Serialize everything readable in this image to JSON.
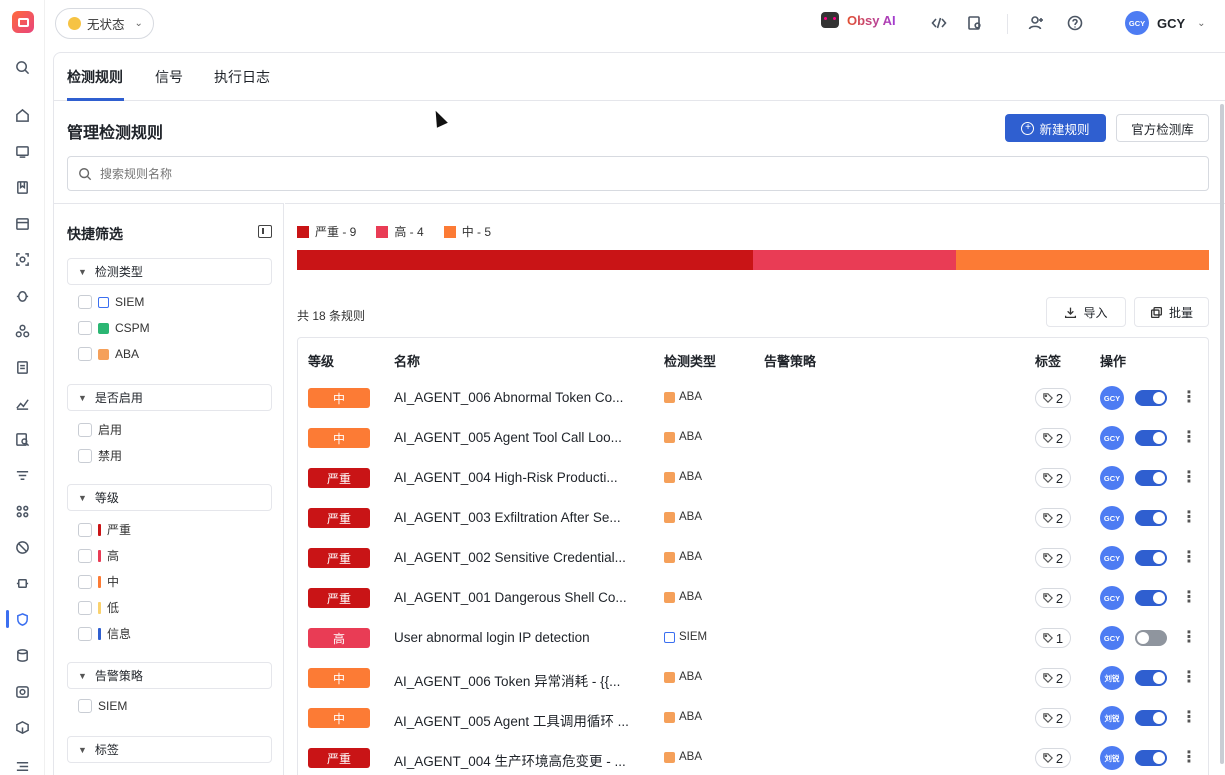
{
  "topbar": {
    "status_label": "无状态",
    "ai_label": "Obsy AI",
    "user_initials": "GCY",
    "user_name": "GCY"
  },
  "tabs": [
    "检测规则",
    "信号",
    "执行日志"
  ],
  "page": {
    "title": "管理检测规则",
    "new_rule_button": "新建规则",
    "official_library_button": "官方检测库",
    "search_placeholder": "搜索规则名称"
  },
  "filters": {
    "title": "快捷筛选",
    "groups": [
      {
        "label": "检测类型",
        "items": [
          "SIEM",
          "CSPM",
          "ABA"
        ]
      },
      {
        "label": "是否启用",
        "items": [
          "启用",
          "禁用"
        ]
      },
      {
        "label": "等级",
        "items": [
          "严重",
          "高",
          "中",
          "低",
          "信息"
        ]
      },
      {
        "label": "告警策略",
        "items": [
          "SIEM"
        ]
      },
      {
        "label": "标签",
        "items": []
      }
    ]
  },
  "colors": {
    "severe": "#c91416",
    "high": "#e93c55",
    "medium": "#fc7b35",
    "low": "#fad26e",
    "info": "#2f5fd0",
    "primary": "#2f5fd0"
  },
  "chart_data": {
    "type": "bar",
    "categories": [
      "严重",
      "高",
      "中"
    ],
    "values": [
      9,
      4,
      5
    ],
    "legend": [
      "严重 - 9",
      "高 - 4",
      "中 - 5"
    ]
  },
  "list": {
    "count_text": "共 18 条规则",
    "import_button": "导入",
    "batch_button": "批量",
    "columns": [
      "等级",
      "名称",
      "检测类型",
      "告警策略",
      "标签",
      "操作"
    ],
    "rows": [
      {
        "level": "中",
        "name": "AI_AGENT_006 Abnormal Token Co...",
        "type": "ABA",
        "tags": "2",
        "owner": "GCY",
        "enabled": true
      },
      {
        "level": "中",
        "name": "AI_AGENT_005 Agent Tool Call Loo...",
        "type": "ABA",
        "tags": "2",
        "owner": "GCY",
        "enabled": true
      },
      {
        "level": "严重",
        "name": "AI_AGENT_004 High-Risk Producti...",
        "type": "ABA",
        "tags": "2",
        "owner": "GCY",
        "enabled": true
      },
      {
        "level": "严重",
        "name": "AI_AGENT_003 Exfiltration After Se...",
        "type": "ABA",
        "tags": "2",
        "owner": "GCY",
        "enabled": true
      },
      {
        "level": "严重",
        "name": "AI_AGENT_002 Sensitive Credential...",
        "type": "ABA",
        "tags": "2",
        "owner": "GCY",
        "enabled": true
      },
      {
        "level": "严重",
        "name": "AI_AGENT_001 Dangerous Shell Co...",
        "type": "ABA",
        "tags": "2",
        "owner": "GCY",
        "enabled": true
      },
      {
        "level": "高",
        "name": "User abnormal login IP detection",
        "type": "SIEM",
        "tags": "1",
        "owner": "GCY",
        "enabled": false
      },
      {
        "level": "中",
        "name": "AI_AGENT_006 Token 异常消耗 - {{...",
        "type": "ABA",
        "tags": "2",
        "owner": "刘锐",
        "enabled": true
      },
      {
        "level": "中",
        "name": "AI_AGENT_005 Agent 工具调用循环 ...",
        "type": "ABA",
        "tags": "2",
        "owner": "刘锐",
        "enabled": true
      },
      {
        "level": "严重",
        "name": "AI_AGENT_004 生产环境高危变更 - ...",
        "type": "ABA",
        "tags": "2",
        "owner": "刘锐",
        "enabled": true
      }
    ]
  }
}
